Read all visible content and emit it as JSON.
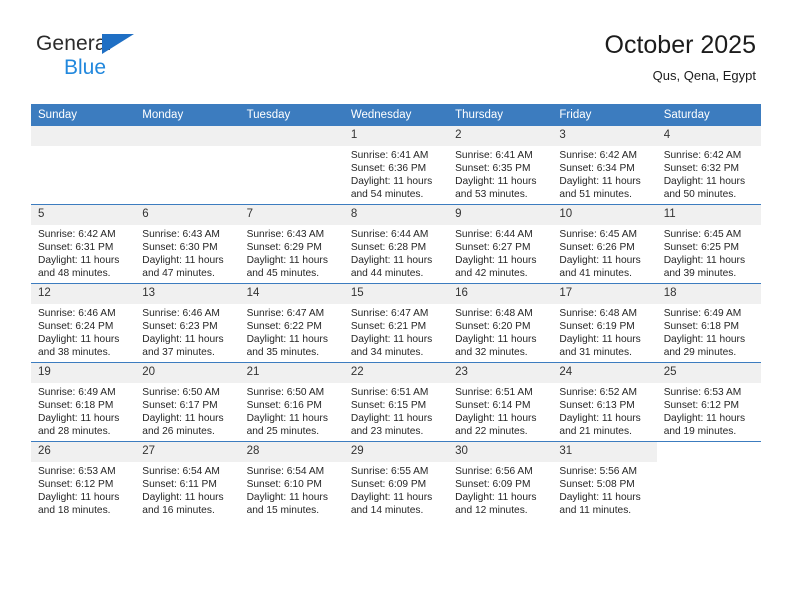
{
  "brand": {
    "name_part1": "General",
    "name_part2": "Blue",
    "accent_color": "#1f6fc4",
    "blue_text_color": "#2288dd"
  },
  "header": {
    "title": "October 2025",
    "subtitle": "Qus, Qena, Egypt"
  },
  "theme": {
    "header_row_bg": "#3c7cbf",
    "header_row_text": "#ffffff",
    "daynum_bg": "#f0f0f0",
    "row_divider": "#3c7cbf"
  },
  "calendar": {
    "weekday_headers": [
      "Sunday",
      "Monday",
      "Tuesday",
      "Wednesday",
      "Thursday",
      "Friday",
      "Saturday"
    ],
    "labels": {
      "sunrise": "Sunrise:",
      "sunset": "Sunset:",
      "daylight": "Daylight:"
    },
    "weeks": [
      [
        {
          "day": "",
          "empty": true
        },
        {
          "day": "",
          "empty": true
        },
        {
          "day": "",
          "empty": true
        },
        {
          "day": "1",
          "sunrise": "Sunrise: 6:41 AM",
          "sunset": "Sunset: 6:36 PM",
          "daylight": "Daylight: 11 hours and 54 minutes."
        },
        {
          "day": "2",
          "sunrise": "Sunrise: 6:41 AM",
          "sunset": "Sunset: 6:35 PM",
          "daylight": "Daylight: 11 hours and 53 minutes."
        },
        {
          "day": "3",
          "sunrise": "Sunrise: 6:42 AM",
          "sunset": "Sunset: 6:34 PM",
          "daylight": "Daylight: 11 hours and 51 minutes."
        },
        {
          "day": "4",
          "sunrise": "Sunrise: 6:42 AM",
          "sunset": "Sunset: 6:32 PM",
          "daylight": "Daylight: 11 hours and 50 minutes."
        }
      ],
      [
        {
          "day": "5",
          "sunrise": "Sunrise: 6:42 AM",
          "sunset": "Sunset: 6:31 PM",
          "daylight": "Daylight: 11 hours and 48 minutes."
        },
        {
          "day": "6",
          "sunrise": "Sunrise: 6:43 AM",
          "sunset": "Sunset: 6:30 PM",
          "daylight": "Daylight: 11 hours and 47 minutes."
        },
        {
          "day": "7",
          "sunrise": "Sunrise: 6:43 AM",
          "sunset": "Sunset: 6:29 PM",
          "daylight": "Daylight: 11 hours and 45 minutes."
        },
        {
          "day": "8",
          "sunrise": "Sunrise: 6:44 AM",
          "sunset": "Sunset: 6:28 PM",
          "daylight": "Daylight: 11 hours and 44 minutes."
        },
        {
          "day": "9",
          "sunrise": "Sunrise: 6:44 AM",
          "sunset": "Sunset: 6:27 PM",
          "daylight": "Daylight: 11 hours and 42 minutes."
        },
        {
          "day": "10",
          "sunrise": "Sunrise: 6:45 AM",
          "sunset": "Sunset: 6:26 PM",
          "daylight": "Daylight: 11 hours and 41 minutes."
        },
        {
          "day": "11",
          "sunrise": "Sunrise: 6:45 AM",
          "sunset": "Sunset: 6:25 PM",
          "daylight": "Daylight: 11 hours and 39 minutes."
        }
      ],
      [
        {
          "day": "12",
          "sunrise": "Sunrise: 6:46 AM",
          "sunset": "Sunset: 6:24 PM",
          "daylight": "Daylight: 11 hours and 38 minutes."
        },
        {
          "day": "13",
          "sunrise": "Sunrise: 6:46 AM",
          "sunset": "Sunset: 6:23 PM",
          "daylight": "Daylight: 11 hours and 37 minutes."
        },
        {
          "day": "14",
          "sunrise": "Sunrise: 6:47 AM",
          "sunset": "Sunset: 6:22 PM",
          "daylight": "Daylight: 11 hours and 35 minutes."
        },
        {
          "day": "15",
          "sunrise": "Sunrise: 6:47 AM",
          "sunset": "Sunset: 6:21 PM",
          "daylight": "Daylight: 11 hours and 34 minutes."
        },
        {
          "day": "16",
          "sunrise": "Sunrise: 6:48 AM",
          "sunset": "Sunset: 6:20 PM",
          "daylight": "Daylight: 11 hours and 32 minutes."
        },
        {
          "day": "17",
          "sunrise": "Sunrise: 6:48 AM",
          "sunset": "Sunset: 6:19 PM",
          "daylight": "Daylight: 11 hours and 31 minutes."
        },
        {
          "day": "18",
          "sunrise": "Sunrise: 6:49 AM",
          "sunset": "Sunset: 6:18 PM",
          "daylight": "Daylight: 11 hours and 29 minutes."
        }
      ],
      [
        {
          "day": "19",
          "sunrise": "Sunrise: 6:49 AM",
          "sunset": "Sunset: 6:18 PM",
          "daylight": "Daylight: 11 hours and 28 minutes."
        },
        {
          "day": "20",
          "sunrise": "Sunrise: 6:50 AM",
          "sunset": "Sunset: 6:17 PM",
          "daylight": "Daylight: 11 hours and 26 minutes."
        },
        {
          "day": "21",
          "sunrise": "Sunrise: 6:50 AM",
          "sunset": "Sunset: 6:16 PM",
          "daylight": "Daylight: 11 hours and 25 minutes."
        },
        {
          "day": "22",
          "sunrise": "Sunrise: 6:51 AM",
          "sunset": "Sunset: 6:15 PM",
          "daylight": "Daylight: 11 hours and 23 minutes."
        },
        {
          "day": "23",
          "sunrise": "Sunrise: 6:51 AM",
          "sunset": "Sunset: 6:14 PM",
          "daylight": "Daylight: 11 hours and 22 minutes."
        },
        {
          "day": "24",
          "sunrise": "Sunrise: 6:52 AM",
          "sunset": "Sunset: 6:13 PM",
          "daylight": "Daylight: 11 hours and 21 minutes."
        },
        {
          "day": "25",
          "sunrise": "Sunrise: 6:53 AM",
          "sunset": "Sunset: 6:12 PM",
          "daylight": "Daylight: 11 hours and 19 minutes."
        }
      ],
      [
        {
          "day": "26",
          "sunrise": "Sunrise: 6:53 AM",
          "sunset": "Sunset: 6:12 PM",
          "daylight": "Daylight: 11 hours and 18 minutes."
        },
        {
          "day": "27",
          "sunrise": "Sunrise: 6:54 AM",
          "sunset": "Sunset: 6:11 PM",
          "daylight": "Daylight: 11 hours and 16 minutes."
        },
        {
          "day": "28",
          "sunrise": "Sunrise: 6:54 AM",
          "sunset": "Sunset: 6:10 PM",
          "daylight": "Daylight: 11 hours and 15 minutes."
        },
        {
          "day": "29",
          "sunrise": "Sunrise: 6:55 AM",
          "sunset": "Sunset: 6:09 PM",
          "daylight": "Daylight: 11 hours and 14 minutes."
        },
        {
          "day": "30",
          "sunrise": "Sunrise: 6:56 AM",
          "sunset": "Sunset: 6:09 PM",
          "daylight": "Daylight: 11 hours and 12 minutes."
        },
        {
          "day": "31",
          "sunrise": "Sunrise: 5:56 AM",
          "sunset": "Sunset: 5:08 PM",
          "daylight": "Daylight: 11 hours and 11 minutes."
        },
        {
          "day": "",
          "empty": true,
          "blank": true
        }
      ]
    ]
  }
}
